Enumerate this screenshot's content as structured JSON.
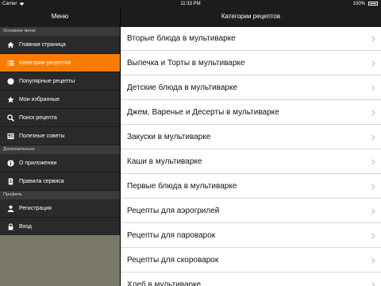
{
  "status_bar": {
    "carrier": "Carrier",
    "time": "11:33 PM",
    "battery": "100%"
  },
  "sidebar": {
    "title": "Меню",
    "sections": [
      {
        "title": "Основное меню",
        "items": [
          {
            "label": "Главная страница",
            "icon": "home-icon"
          },
          {
            "label": "Категории рецептов",
            "icon": "list-icon",
            "active": true
          },
          {
            "label": "Популярные рецепты",
            "icon": "circle-icon"
          },
          {
            "label": "Мои избранные",
            "icon": "star-icon"
          },
          {
            "label": "Поиск рецепта",
            "icon": "search-icon"
          },
          {
            "label": "Полезные советы",
            "icon": "newspaper-icon"
          }
        ]
      },
      {
        "title": "Дополнительно",
        "items": [
          {
            "label": "О приложении",
            "icon": "info-icon"
          },
          {
            "label": "Правила сервиса",
            "icon": "document-icon"
          }
        ]
      },
      {
        "title": "Профиль",
        "items": [
          {
            "label": "Регистрация",
            "icon": "user-icon"
          },
          {
            "label": "Вход",
            "icon": "lock-icon"
          }
        ]
      }
    ]
  },
  "main": {
    "title": "Категории рецептов",
    "categories": [
      "Вторые блюда в мультиварке",
      "Выпечка и Торты в мультиварке",
      "Детские блюда в мультиварке",
      "Джем, Варенье и Десерты в мультиварке",
      "Закуски в мультиварке",
      "Каши в мультиварке",
      "Первые блюда в мультиварке",
      "Рецепты для аэрогрилей",
      "Рецепты для пароварок",
      "Рецепты для скороварок",
      "Хлеб в мультиварке"
    ]
  },
  "colors": {
    "accent": "#f97c00",
    "sidebar_bg": "#2a2a2a",
    "header_bg": "#1c1c1c",
    "section_bg": "#3b3b3b",
    "chevron": "#c7c7cc"
  }
}
